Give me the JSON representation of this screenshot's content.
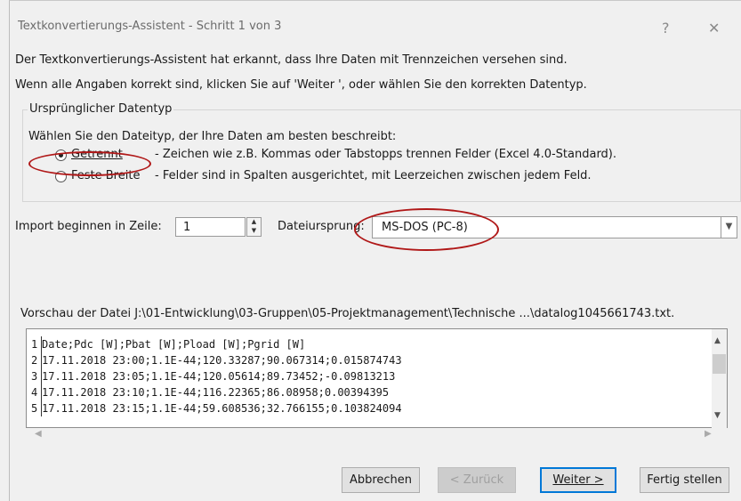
{
  "window": {
    "title": "Textkonvertierungs-Assistent - Schritt 1 von 3",
    "help_button": "?",
    "close_button": "✕"
  },
  "intro": {
    "line1": "Der Textkonvertierungs-Assistent hat erkannt, dass Ihre Daten mit Trennzeichen versehen sind.",
    "line2": "Wenn alle Angaben korrekt sind, klicken Sie auf 'Weiter ', oder wählen Sie den korrekten Datentyp."
  },
  "datatype_group": {
    "caption": "Ursprünglicher Datentyp",
    "prompt": "Wählen Sie den Dateityp, der Ihre Daten am besten beschreibt:",
    "options": [
      {
        "label": "Getrennt",
        "description": "- Zeichen wie z.B. Kommas oder Tabstopps trennen Felder (Excel 4.0-Standard).",
        "selected": true
      },
      {
        "label": "Feste Breite",
        "description": "- Felder sind in Spalten ausgerichtet, mit Leerzeichen zwischen jedem Feld.",
        "selected": false
      }
    ]
  },
  "import_row": {
    "label": "Import beginnen in Zeile:",
    "value": "1"
  },
  "origin": {
    "label": "Dateiursprung:",
    "value": "MS-DOS (PC-8)"
  },
  "preview": {
    "caption": "Vorschau der Datei J:\\01-Entwicklung\\03-Gruppen\\05-Projektmanagement\\Technische ...\\datalog1045661743.txt.",
    "rows": [
      {
        "num": "1",
        "text": "Date;Pdc [W];Pbat [W];Pload [W];Pgrid [W]"
      },
      {
        "num": "2",
        "text": "17.11.2018 23:00;1.1E-44;120.33287;90.067314;0.015874743"
      },
      {
        "num": "3",
        "text": "17.11.2018 23:05;1.1E-44;120.05614;89.73452;-0.09813213"
      },
      {
        "num": "4",
        "text": "17.11.2018 23:10;1.1E-44;116.22365;86.08958;0.00394395"
      },
      {
        "num": "5",
        "text": "17.11.2018 23:15;1.1E-44;59.608536;32.766155;0.103824094"
      }
    ]
  },
  "buttons": {
    "cancel": "Abbrechen",
    "back": "< Zurück",
    "next": "Weiter >",
    "finish": "Fertig stellen"
  },
  "colors": {
    "annotation": "#b01818",
    "default_button_border": "#0078d7"
  }
}
